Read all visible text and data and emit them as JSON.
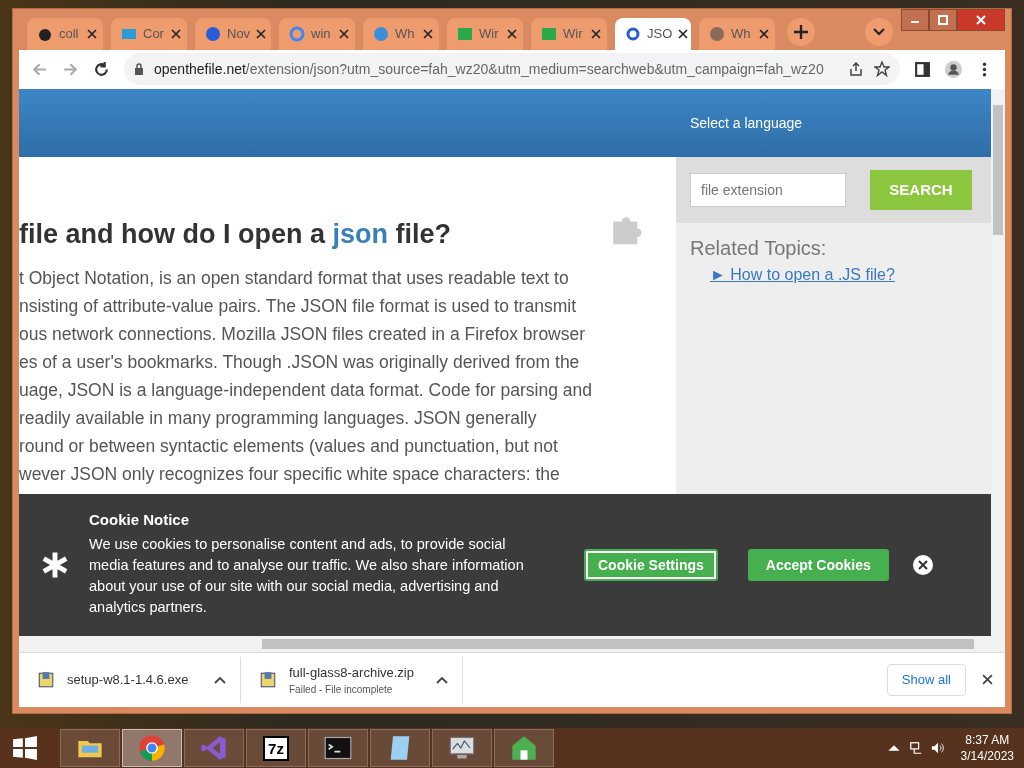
{
  "tabs": [
    {
      "title": "coll",
      "selected": false
    },
    {
      "title": "Cor",
      "selected": false
    },
    {
      "title": "Nov",
      "selected": false
    },
    {
      "title": "win",
      "selected": false
    },
    {
      "title": "Wh",
      "selected": false
    },
    {
      "title": "Wir",
      "selected": false
    },
    {
      "title": "Wir",
      "selected": false
    },
    {
      "title": "JSO",
      "selected": true
    },
    {
      "title": "Wh",
      "selected": false
    }
  ],
  "address": {
    "host": "openthefile.net",
    "path": "/extension/json?utm_source=fah_wz20&utm_medium=searchweb&utm_campaign=fah_wz20"
  },
  "header": {
    "language": "Select a language"
  },
  "search": {
    "placeholder": "file extension",
    "button": "SEARCH"
  },
  "article": {
    "heading_before": "file and how do I open a ",
    "heading_highlight": "json",
    "heading_after": " file?",
    "lines": [
      "t Object Notation, is an open standard format that uses readable text to",
      "nsisting of attribute-value pairs. The JSON file format is used to transmit",
      "ous network connections. Mozilla JSON files created in a Firefox browser",
      "es of a user's bookmarks. Though .JSON was originally derived from the",
      "uage, JSON is a language-independent data format. Code for parsing and",
      "readily available in many programming languages. JSON generally",
      "round or between syntactic elements (values and punctuation, but not",
      "wever JSON only recognizes four specific white space characters: the"
    ]
  },
  "sidebar": {
    "title": "Related Topics:",
    "links": [
      "► How to open a .JS file?"
    ]
  },
  "cookie": {
    "title": "Cookie Notice",
    "text": "We use cookies to personalise content and ads, to provide social media features and to analyse our traffic. We also share information about your use of our site with our social media, advertising and analytics partners.",
    "settings": "Cookie Settings",
    "accept": "Accept Cookies"
  },
  "downloads": {
    "items": [
      {
        "name": "setup-w8.1-1.4.6.exe"
      },
      {
        "name": "full-glass8-archive.zip",
        "status": "Failed - File incomplete"
      }
    ],
    "show_all": "Show all"
  },
  "taskbar": {
    "apps": [
      {
        "selected": false
      },
      {
        "selected": true
      },
      {
        "selected": false
      },
      {
        "selected": false,
        "label": "7z"
      },
      {
        "selected": false
      },
      {
        "selected": false
      },
      {
        "selected": false
      },
      {
        "selected": false
      }
    ],
    "time": "8:37 AM",
    "date": "3/14/2023"
  }
}
